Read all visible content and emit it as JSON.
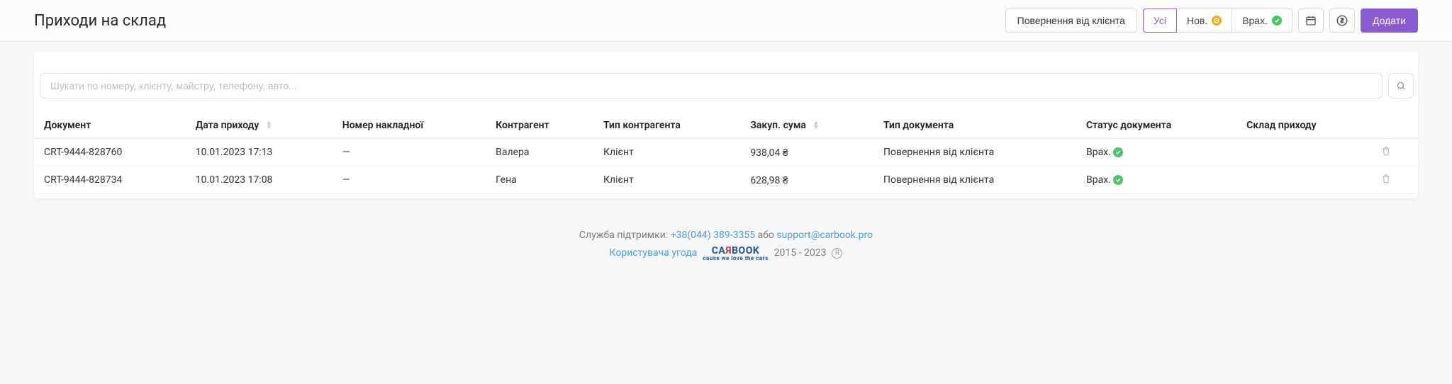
{
  "header": {
    "title": "Приходи на склад",
    "return_btn": "Повернення від клієнта",
    "filters": {
      "all": "Усі",
      "new": "Нов.",
      "done": "Врах."
    },
    "add_btn": "Додати"
  },
  "search": {
    "placeholder": "Шукати по номеру, клієнту, майстру, телефону, авто..."
  },
  "table": {
    "cols": {
      "doc": "Документ",
      "date": "Дата приходу",
      "invoice": "Номер накладної",
      "counterparty": "Контрагент",
      "cp_type": "Тип контрагента",
      "amount": "Закуп. сума",
      "doc_type": "Тип документа",
      "doc_status": "Статус документа",
      "warehouse": "Склад приходу"
    },
    "rows": [
      {
        "doc": "CRT-9444-828760",
        "date": "10.01.2023 17:13",
        "invoice": "—",
        "counterparty": "Валера",
        "cp_type": "Клієнт",
        "amount": "938,04 ₴",
        "doc_type": "Повернення від клієнта",
        "doc_status": "Врах.",
        "warehouse": ""
      },
      {
        "doc": "CRT-9444-828734",
        "date": "10.01.2023 17:08",
        "invoice": "—",
        "counterparty": "Гена",
        "cp_type": "Клієнт",
        "amount": "628,98 ₴",
        "doc_type": "Повернення від клієнта",
        "doc_status": "Врах.",
        "warehouse": ""
      }
    ]
  },
  "footer": {
    "support_label": "Служба підтримки:",
    "phone": "+38(044) 389-3355",
    "or": "або",
    "email": "support@carbook.pro",
    "agreement": "Користувача угода",
    "years": "2015 - 2023"
  }
}
